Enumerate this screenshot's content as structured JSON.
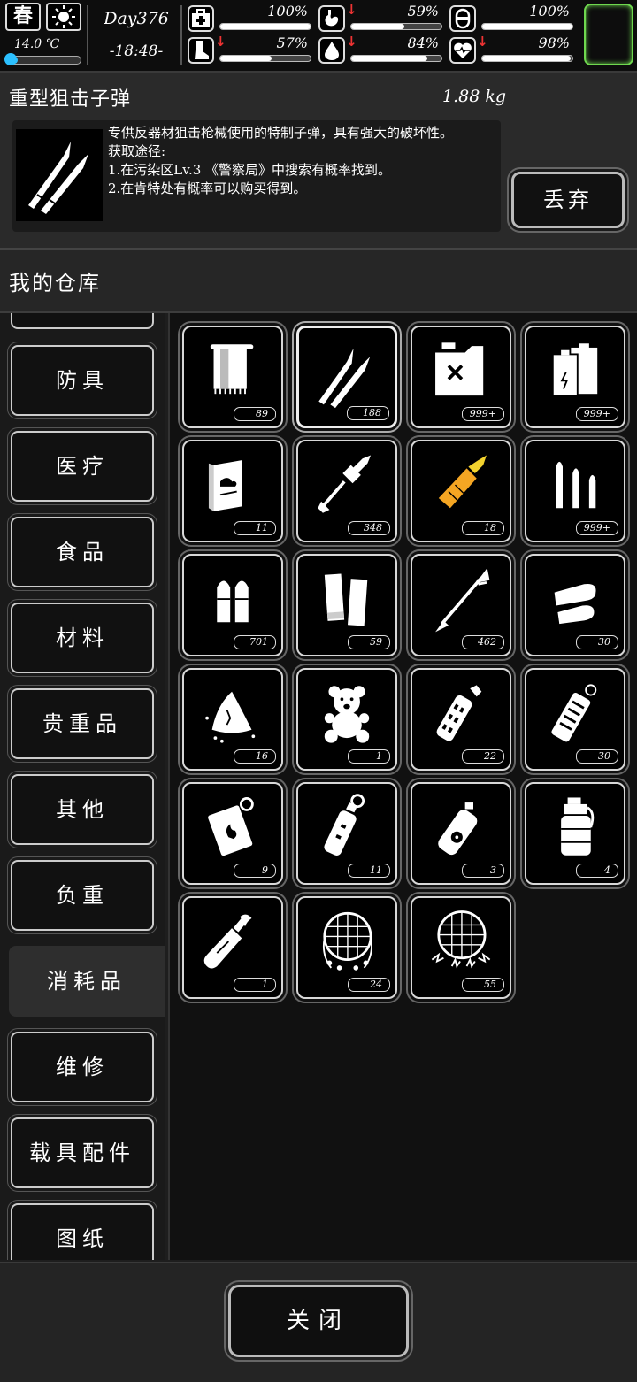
{
  "status_bar": {
    "season": "春",
    "temperature": "14.0 ℃",
    "temperature_level": 0.15,
    "day": "Day376",
    "time": "-18:48-",
    "stats": [
      {
        "id": "health",
        "icon": "first-aid-icon",
        "value": "100%",
        "level": 1.0,
        "decreasing": false
      },
      {
        "id": "hunger",
        "icon": "stomach-icon",
        "value": "59%",
        "level": 0.59,
        "decreasing": true
      },
      {
        "id": "stamina",
        "icon": "pill-icon",
        "value": "100%",
        "level": 1.0,
        "decreasing": false
      },
      {
        "id": "leg",
        "icon": "leg-icon",
        "value": "57%",
        "level": 0.57,
        "decreasing": true
      },
      {
        "id": "thirst",
        "icon": "water-drop-icon",
        "value": "84%",
        "level": 0.84,
        "decreasing": true
      },
      {
        "id": "mood",
        "icon": "heart-icon",
        "value": "98%",
        "level": 0.98,
        "decreasing": true
      }
    ]
  },
  "detail": {
    "name": "重型狙击子弹",
    "weight": "1.88 kg",
    "description": "专供反器材狙击枪械使用的特制子弹，具有强大的破坏性。\n获取途径:\n1.在污染区Lv.3 《警察局》中搜索有概率找到。\n2.在肯特处有概率可以购买得到。",
    "discard_label": "丢弃"
  },
  "warehouse": {
    "title": "我的仓库",
    "categories": [
      "防具",
      "医疗",
      "食品",
      "材料",
      "贵重品",
      "其他",
      "负重",
      "消耗品",
      "维修",
      "载具配件",
      "图纸"
    ],
    "active_category": "消耗品",
    "items": [
      {
        "icon": "towel-icon",
        "count": "89"
      },
      {
        "icon": "heavy-sniper-bullets-icon",
        "count": "188",
        "selected": true
      },
      {
        "icon": "jerrycan-icon",
        "count": "999+"
      },
      {
        "icon": "batteries-icon",
        "count": "999+"
      },
      {
        "icon": "book-icon",
        "count": "11"
      },
      {
        "icon": "rpg-rocket-icon",
        "count": "348"
      },
      {
        "icon": "golden-rocket-icon",
        "count": "18"
      },
      {
        "icon": "rifle-bullets-icon",
        "count": "999+"
      },
      {
        "icon": "pistol-bullets-icon",
        "count": "701"
      },
      {
        "icon": "shotgun-shells-icon",
        "count": "59"
      },
      {
        "icon": "arrow-icon",
        "count": "462"
      },
      {
        "icon": "slugs-icon",
        "count": "30"
      },
      {
        "icon": "wet-rag-icon",
        "count": "16"
      },
      {
        "icon": "teddy-bear-icon",
        "count": "1"
      },
      {
        "icon": "flashbang-icon",
        "count": "22"
      },
      {
        "icon": "stun-grenade-icon",
        "count": "30"
      },
      {
        "icon": "incendiary-grenade-icon",
        "count": "9"
      },
      {
        "icon": "smoke-grenade-icon",
        "count": "11"
      },
      {
        "icon": "toxic-grenade-icon",
        "count": "3"
      },
      {
        "icon": "frag-grenade-icon",
        "count": "4"
      },
      {
        "icon": "molotov-icon",
        "count": "1"
      },
      {
        "icon": "net-icon",
        "count": "24"
      },
      {
        "icon": "electric-net-icon",
        "count": "55"
      }
    ]
  },
  "footer": {
    "close_label": "关闭"
  }
}
